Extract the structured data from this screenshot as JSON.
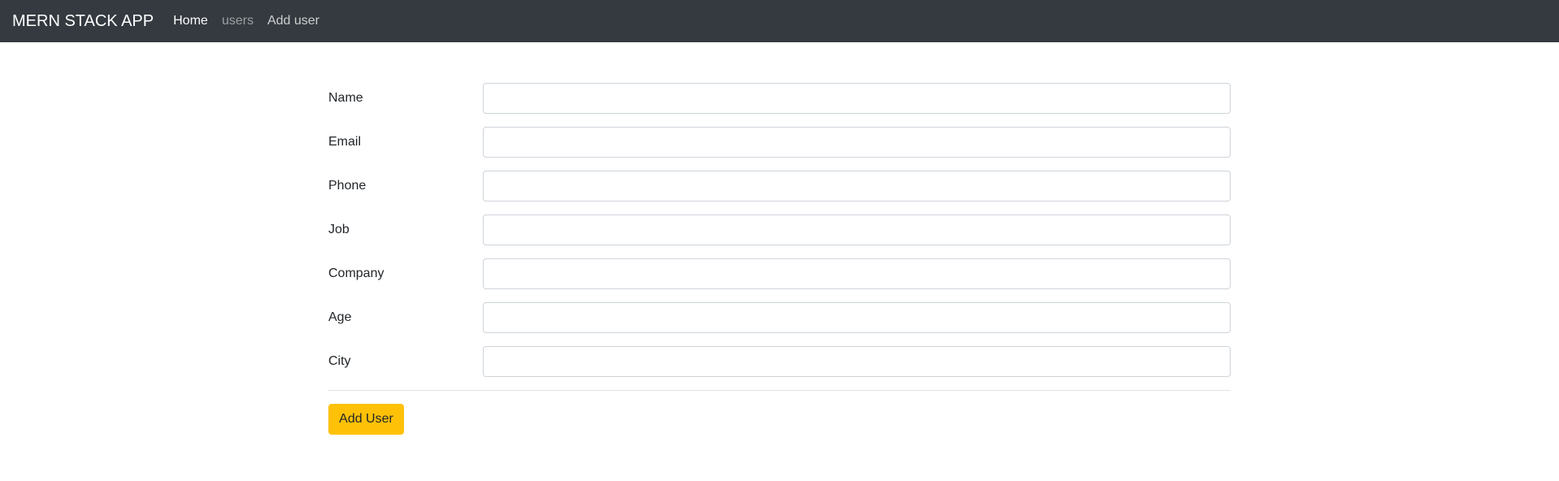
{
  "navbar": {
    "brand": "MERN STACK APP",
    "links": [
      {
        "label": "Home"
      },
      {
        "label": "users"
      },
      {
        "label": "Add user"
      }
    ]
  },
  "form": {
    "fields": [
      {
        "label": "Name",
        "value": ""
      },
      {
        "label": "Email",
        "value": ""
      },
      {
        "label": "Phone",
        "value": ""
      },
      {
        "label": "Job",
        "value": ""
      },
      {
        "label": "Company",
        "value": ""
      },
      {
        "label": "Age",
        "value": ""
      },
      {
        "label": "City",
        "value": ""
      }
    ],
    "submit_label": "Add User"
  },
  "colors": {
    "navbar_bg": "#343a40",
    "button_bg": "#ffc107"
  }
}
